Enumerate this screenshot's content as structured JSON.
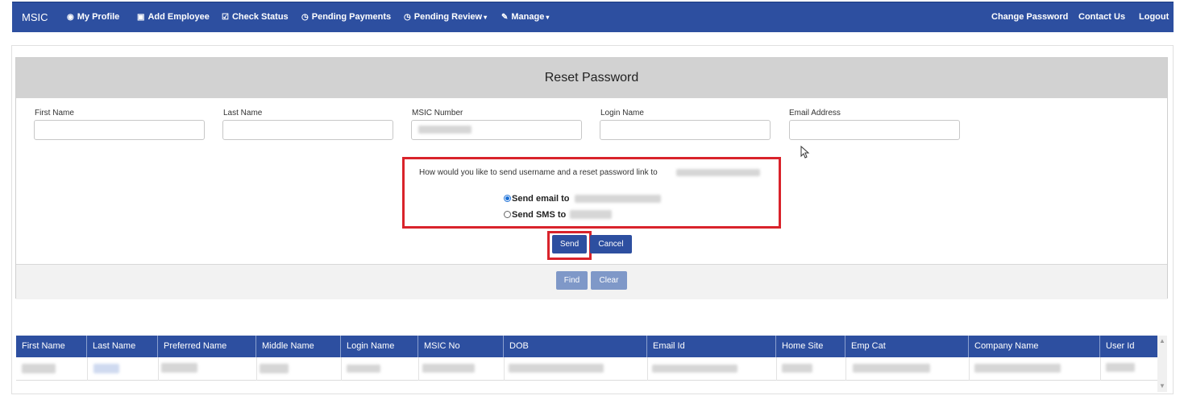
{
  "nav": {
    "brand": "MSIC",
    "items": [
      {
        "label": "My Profile",
        "icon": "user-circle-icon"
      },
      {
        "label": "Add Employee",
        "icon": "id-card-icon"
      },
      {
        "label": "Check Status",
        "icon": "check-square-icon"
      },
      {
        "label": "Pending Payments",
        "icon": "clock-icon"
      },
      {
        "label": "Pending Review",
        "icon": "clock-icon"
      },
      {
        "label": "Manage",
        "icon": "wrench-icon"
      }
    ],
    "right": [
      "Change Password",
      "Contact Us",
      "Logout"
    ]
  },
  "panel": {
    "title": "Reset Password",
    "fields": [
      "First Name",
      "Last Name",
      "MSIC Number",
      "Login Name",
      "Email Address"
    ],
    "question": "How would you like to send username and a reset password link to",
    "options": [
      {
        "label": "Send email to",
        "selected": true
      },
      {
        "label": "Send SMS to",
        "selected": false
      }
    ],
    "send_label": "Send",
    "cancel_label": "Cancel",
    "find_label": "Find",
    "clear_label": "Clear"
  },
  "table": {
    "columns": [
      "First Name",
      "Last Name",
      "Preferred Name",
      "Middle Name",
      "Login Name",
      "MSIC No",
      "DOB",
      "Email Id",
      "Home Site",
      "Emp Cat",
      "Company Name",
      "User Id"
    ]
  },
  "colors": {
    "primary": "#2d4fa0",
    "highlight": "#d9232b",
    "header_bg": "#d2d2d2"
  }
}
